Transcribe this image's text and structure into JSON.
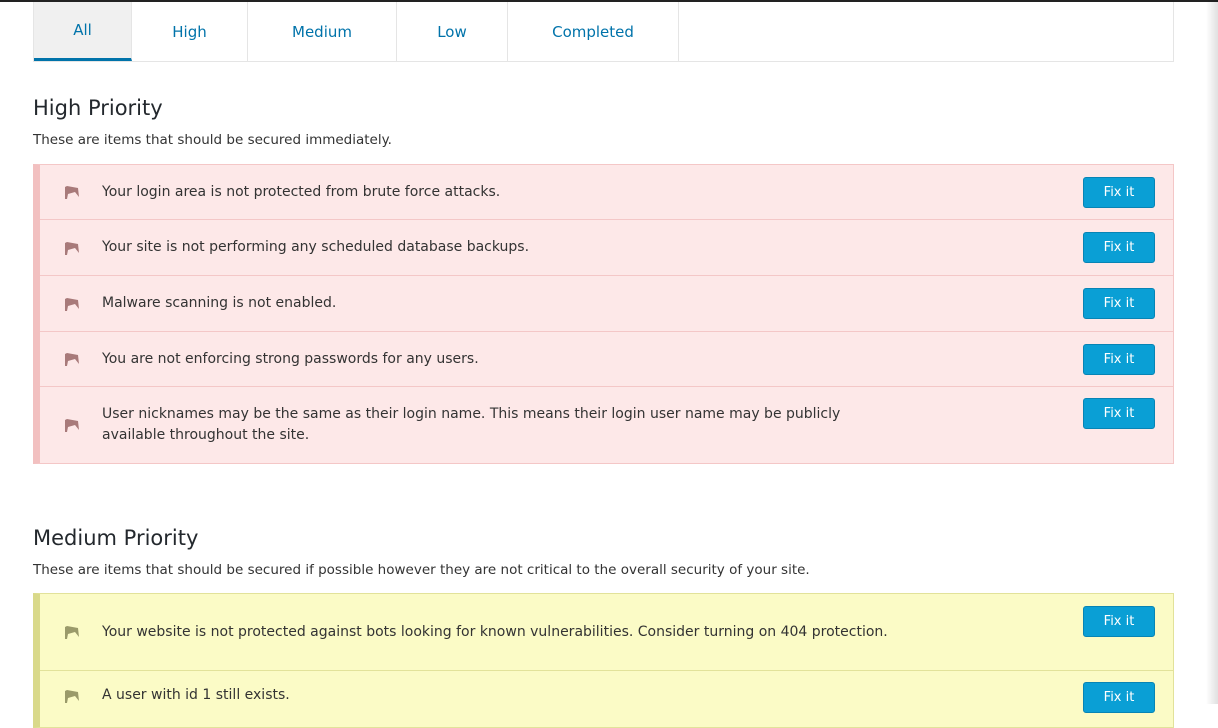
{
  "tabs": [
    {
      "label": "All",
      "active": true
    },
    {
      "label": "High",
      "active": false
    },
    {
      "label": "Medium",
      "active": false
    },
    {
      "label": "Low",
      "active": false
    },
    {
      "label": "Completed",
      "active": false
    }
  ],
  "high": {
    "title": "High Priority",
    "description": "These are items that should be secured immediately.",
    "items": [
      {
        "text": "Your login area is not protected from brute force attacks.",
        "button": "Fix it"
      },
      {
        "text": "Your site is not performing any scheduled database backups.",
        "button": "Fix it"
      },
      {
        "text": "Malware scanning is not enabled.",
        "button": "Fix it"
      },
      {
        "text": "You are not enforcing strong passwords for any users.",
        "button": "Fix it"
      },
      {
        "text": "User nicknames may be the same as their login name. This means their login user name may be publicly available throughout the site.",
        "button": "Fix it"
      }
    ]
  },
  "medium": {
    "title": "Medium Priority",
    "description": "These are items that should be secured if possible however they are not critical to the overall security of your site.",
    "items": [
      {
        "text": "Your website is not protected against bots looking for known vulnerabilities. Consider turning on 404 protection.",
        "button": "Fix it"
      },
      {
        "text": "A user with id 1 still exists.",
        "button": "Fix it"
      }
    ]
  },
  "colors": {
    "accent": "#0073aa",
    "button": "#0a9fd5",
    "high_bg": "#fde8e8",
    "medium_bg": "#fbfbc6",
    "high_flag": "#a87a7a",
    "medium_flag": "#9a9a6a"
  },
  "icons": {
    "item_flag": "flag-icon"
  }
}
